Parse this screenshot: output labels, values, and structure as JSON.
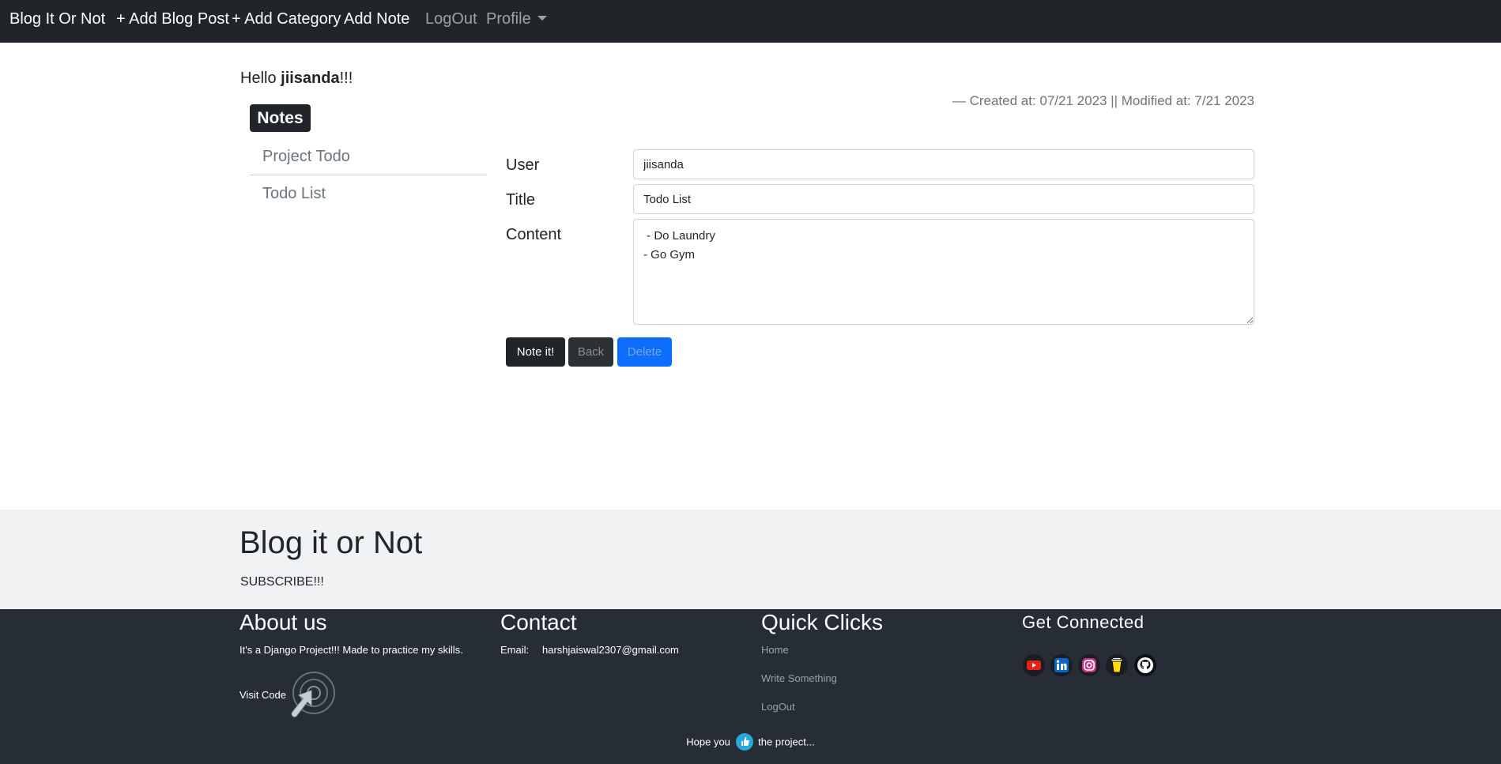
{
  "navbar": {
    "brand": "Blog It Or Not",
    "add_blog_post": "+ Add Blog Post",
    "add_category": "+ Add Category",
    "add_note": "Add Note",
    "logout": "LogOut",
    "profile": "Profile"
  },
  "greeting": {
    "prefix": "Hello ",
    "username": "jiisanda",
    "suffix": "!!!"
  },
  "meta": "—  Created at: 07/21 2023 || Modified at: 7/21 2023",
  "notes": {
    "heading": "Notes",
    "items": [
      {
        "label": "Project Todo"
      },
      {
        "label": "Todo List"
      }
    ]
  },
  "form": {
    "user_label": "User",
    "user_value": "jiisanda",
    "title_label": "Title",
    "title_value": "Todo List",
    "content_label": "Content",
    "content_value": " - Do Laundry\n- Go Gym"
  },
  "buttons": {
    "save": "Note it!",
    "back": "Back",
    "delete": "Delete"
  },
  "footer": {
    "brand": "Blog it or Not",
    "subscribe": "SUBSCRIBE!!!",
    "about": {
      "heading": "About us",
      "text": "It's a Django Project!!! Made to practice my skills.",
      "visit": "Visit Code"
    },
    "contact": {
      "heading": "Contact",
      "email_label": "Email:",
      "email": "harshjaiswal2307@gmail.com"
    },
    "quick": {
      "heading": "Quick Clicks",
      "links": [
        "Home",
        "Write Something",
        "LogOut"
      ]
    },
    "connected": {
      "heading": "Get Connected",
      "icons": [
        "youtube-icon",
        "linkedin-icon",
        "instagram-icon",
        "buymeacoffee-icon",
        "github-icon"
      ]
    },
    "hope_prefix": "Hope you",
    "hope_suffix": "the project..."
  },
  "colors": {
    "navbar": "#212529",
    "primary": "#0d6efd",
    "footer_dark": "#272d37",
    "footer_light": "#f1f2f4"
  }
}
